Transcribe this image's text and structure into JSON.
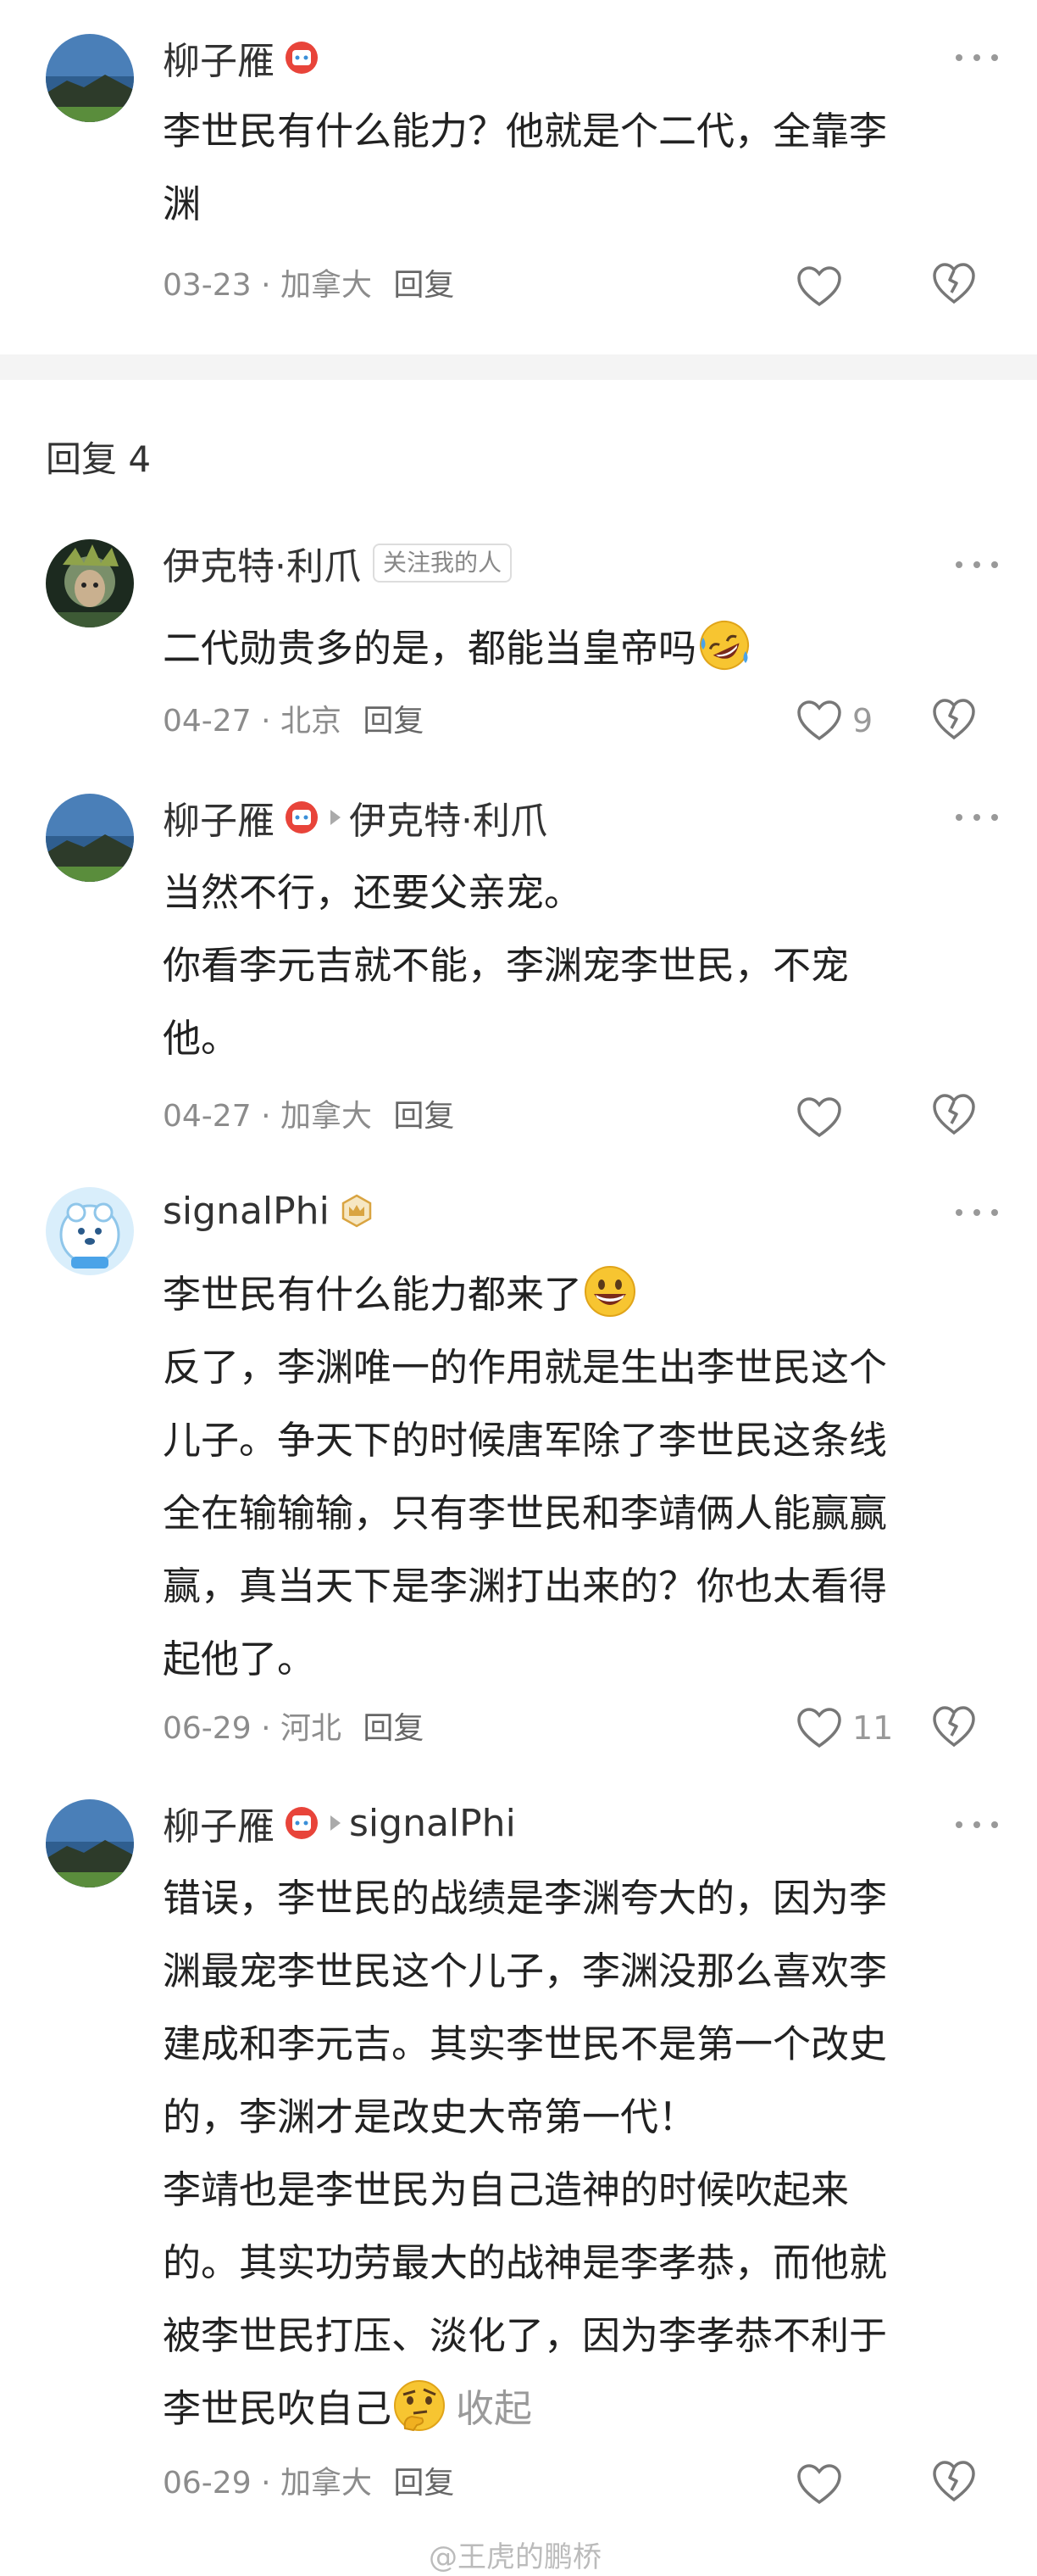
{
  "root_comment": {
    "name": "柳子雁",
    "text_lines": [
      "李世民有什么能力？他就是个二代，全靠李",
      "渊"
    ],
    "date": "03-23",
    "location": "加拿大",
    "reply_label": "回复"
  },
  "replies_header": "回复 4",
  "replies": [
    {
      "name": "伊克特·利爪",
      "tag": "关注我的人",
      "text_lines": [
        "二代勋贵多的是，都能当皇帝吗"
      ],
      "emoji": "rofl-emoji",
      "date": "04-27",
      "location": "北京",
      "reply_label": "回复",
      "likes": "9"
    },
    {
      "name": "柳子雁",
      "reply_to": "伊克特·利爪",
      "text_lines": [
        "当然不行，还要父亲宠。",
        "你看李元吉就不能，李渊宠李世民，不宠",
        "他。"
      ],
      "date": "04-27",
      "location": "加拿大",
      "reply_label": "回复"
    },
    {
      "name": "signalPhi",
      "text_lines": [
        "李世民有什么能力都来了",
        "反了，李渊唯一的作用就是生出李世民这个",
        "儿子。争天下的时候唐军除了李世民这条线",
        "全在输输输，只有李世民和李靖俩人能赢赢",
        "赢，真当天下是李渊打出来的？你也太看得",
        "起他了。"
      ],
      "emoji": "grin-emoji",
      "date": "06-29",
      "location": "河北",
      "reply_label": "回复",
      "likes": "11"
    },
    {
      "name": "柳子雁",
      "reply_to": "signalPhi",
      "text_lines": [
        "错误，李世民的战绩是李渊夸大的，因为李",
        "渊最宠李世民这个儿子，李渊没那么喜欢李",
        "建成和李元吉。其实李世民不是第一个改史",
        "的，李渊才是改史大帝第一代！",
        "李靖也是李世民为自己造神的时候吹起来",
        "的。其实功劳最大的战神是李孝恭，而他就",
        "被李世民打压、淡化了，因为李孝恭不利于",
        "李世民吹自己"
      ],
      "emoji": "thinking-emoji",
      "collapse_label": "收起",
      "date": "06-29",
      "location": "加拿大",
      "reply_label": "回复"
    }
  ],
  "watermark": "@王虎的鹏桥",
  "colors": {
    "badge_red": "#e8443a",
    "gold_badge": "#d9a441",
    "meta_gray": "#8c8c8c"
  }
}
